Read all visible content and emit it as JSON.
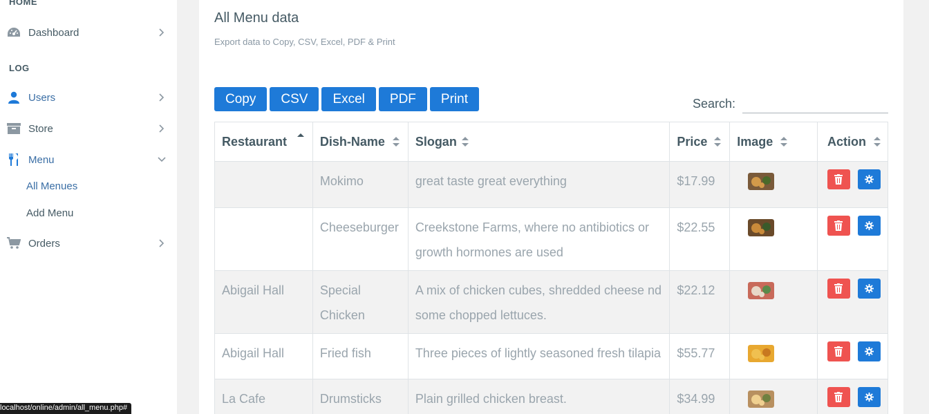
{
  "sidebar": {
    "home_label": "HOME",
    "log_label": "LOG",
    "items": [
      {
        "label": "Dashboard",
        "icon": "dashboard-icon"
      },
      {
        "label": "Users",
        "icon": "user-icon"
      },
      {
        "label": "Store",
        "icon": "archive-icon"
      },
      {
        "label": "Menu",
        "icon": "cutlery-icon"
      },
      {
        "label": "Orders",
        "icon": "cart-icon"
      }
    ],
    "menu_sub": [
      {
        "label": "All Menues",
        "active": true
      },
      {
        "label": "Add Menu",
        "active": false
      }
    ]
  },
  "page": {
    "title": "All Menu data",
    "subtitle": "Export data to Copy, CSV, Excel, PDF & Print"
  },
  "export_buttons": [
    "Copy",
    "CSV",
    "Excel",
    "PDF",
    "Print"
  ],
  "search": {
    "label": "Search:",
    "value": ""
  },
  "table": {
    "headers": [
      "Restaurant",
      "Dish-Name",
      "Slogan",
      "Price",
      "Image",
      "Action"
    ],
    "rows": [
      {
        "restaurant": "",
        "dish": "Mokimo",
        "slogan": "great taste great everything",
        "price": "$17.99"
      },
      {
        "restaurant": "",
        "dish": "Cheeseburger",
        "slogan": "Creekstone Farms, where no antibiotics or growth hormones are used",
        "price": "$22.55"
      },
      {
        "restaurant": "Abigail Hall",
        "dish": "Special Chicken",
        "slogan": "A mix of chicken cubes, shredded cheese nd some chopped lettuces.",
        "price": "$22.12"
      },
      {
        "restaurant": "Abigail Hall",
        "dish": "Fried fish",
        "slogan": "Three pieces of lightly seasoned fresh tilapia",
        "price": "$55.77"
      },
      {
        "restaurant": "La Cafe",
        "dish": "Drumsticks",
        "slogan": "Plain grilled chicken breast.",
        "price": "$34.99"
      }
    ]
  },
  "status_url": "localhost/online/admin/all_menu.php#",
  "colors": {
    "primary": "#1e7ad8",
    "danger": "#ef5350",
    "text": "#455a64",
    "muted": "#9aa5ad"
  }
}
